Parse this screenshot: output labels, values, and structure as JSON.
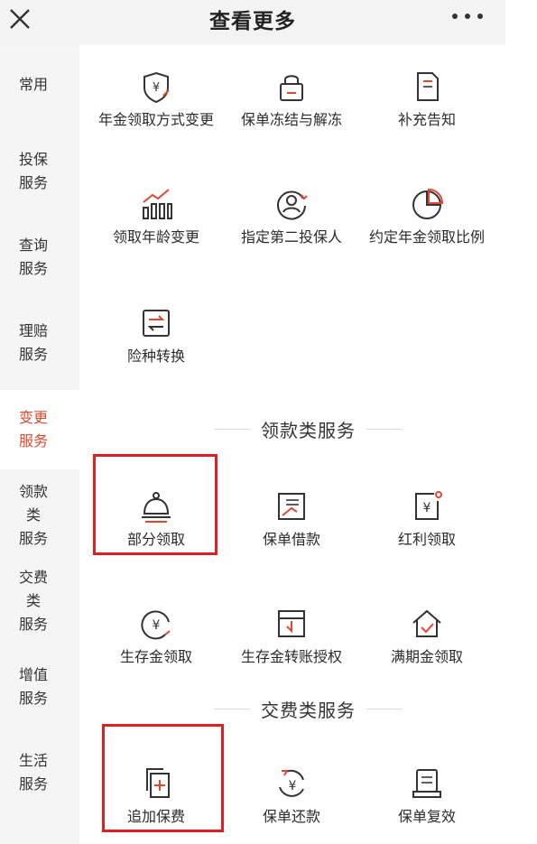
{
  "header": {
    "title": "查看更多"
  },
  "sidebar": {
    "items": [
      {
        "label": "常用"
      },
      {
        "label": "投保\n服务"
      },
      {
        "label": "查询\n服务"
      },
      {
        "label": "理赔\n服务"
      },
      {
        "label": "变更\n服务",
        "active": true
      },
      {
        "label": "领款类\n服务"
      },
      {
        "label": "交费类\n服务"
      },
      {
        "label": "增值\n服务"
      },
      {
        "label": "生活\n服务"
      }
    ]
  },
  "change_services": {
    "items": [
      {
        "label": "年金领取方式变更",
        "icon": "shield-yen-icon"
      },
      {
        "label": "保单冻结与解冻",
        "icon": "lock-icon"
      },
      {
        "label": "补充告知",
        "icon": "document-icon"
      },
      {
        "label": "领取年龄变更",
        "icon": "bar-chart-icon"
      },
      {
        "label": "指定第二投保人",
        "icon": "person-circle-icon"
      },
      {
        "label": "约定年金领取比例",
        "icon": "pie-chart-icon"
      },
      {
        "label": "险种转换",
        "icon": "swap-icon"
      }
    ]
  },
  "withdrawal_services": {
    "title": "领款类服务",
    "items": [
      {
        "label": "部分领取",
        "icon": "bell-icon",
        "highlighted": true
      },
      {
        "label": "保单借款",
        "icon": "loan-document-icon"
      },
      {
        "label": "红利领取",
        "icon": "dividend-yen-icon"
      },
      {
        "label": "生存金领取",
        "icon": "yen-circle-icon"
      },
      {
        "label": "生存金转账授权",
        "icon": "transfer-icon"
      },
      {
        "label": "满期金领取",
        "icon": "house-check-icon"
      }
    ]
  },
  "payment_services": {
    "title": "交费类服务",
    "items": [
      {
        "label": "追加保费",
        "icon": "add-document-icon",
        "highlighted": true
      },
      {
        "label": "保单还款",
        "icon": "yen-refresh-icon"
      },
      {
        "label": "保单复效",
        "icon": "clipboard-icon"
      }
    ]
  },
  "colors": {
    "accent": "#e0482f",
    "highlight_box": "#e02020",
    "icon_stroke": "#333333"
  }
}
